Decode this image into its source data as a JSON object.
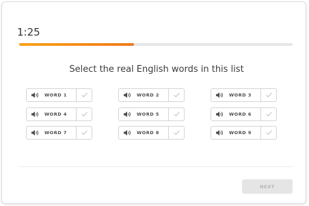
{
  "timer": {
    "text": "1:25"
  },
  "progress": {
    "fraction": 0.42,
    "fill_color": "#f0841c",
    "track_color": "#e6e6e6"
  },
  "instruction": "Select the real English words in this list",
  "words": [
    {
      "label": "WORD 1"
    },
    {
      "label": "WORD 2"
    },
    {
      "label": "WORD 3"
    },
    {
      "label": "WORD 4"
    },
    {
      "label": "WORD 5"
    },
    {
      "label": "WORD 6"
    },
    {
      "label": "WORD 7"
    },
    {
      "label": "WORD 8"
    },
    {
      "label": "WORD 9"
    }
  ],
  "icons": {
    "word_audio": "speaker-icon",
    "word_check": "checkmark-icon"
  },
  "footer": {
    "next_label": "NEXT"
  }
}
